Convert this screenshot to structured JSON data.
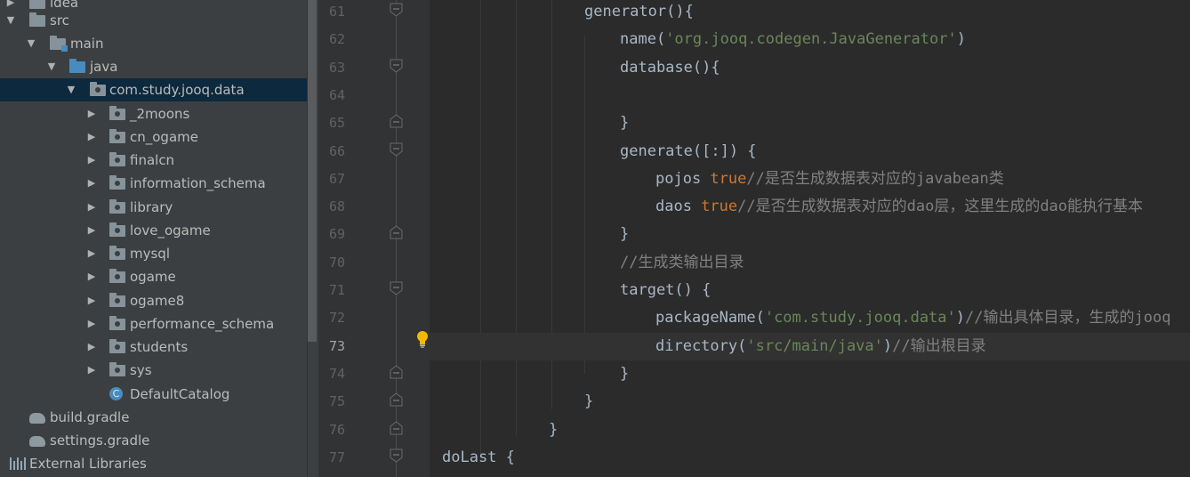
{
  "project_tree": {
    "items": [
      {
        "label": "idea",
        "kind": "folder",
        "expanded": false
      },
      {
        "label": "src",
        "kind": "folder",
        "expanded": true
      },
      {
        "label": "main",
        "kind": "source-folder",
        "expanded": true
      },
      {
        "label": "java",
        "kind": "source-root",
        "expanded": true
      },
      {
        "label": "com.study.jooq.data",
        "kind": "package",
        "expanded": true,
        "selected": true
      },
      {
        "label": "_2moons",
        "kind": "package",
        "expanded": false
      },
      {
        "label": "cn_ogame",
        "kind": "package",
        "expanded": false
      },
      {
        "label": "finalcn",
        "kind": "package",
        "expanded": false
      },
      {
        "label": "information_schema",
        "kind": "package",
        "expanded": false
      },
      {
        "label": "library",
        "kind": "package",
        "expanded": false
      },
      {
        "label": "love_ogame",
        "kind": "package",
        "expanded": false
      },
      {
        "label": "mysql",
        "kind": "package",
        "expanded": false
      },
      {
        "label": "ogame",
        "kind": "package",
        "expanded": false
      },
      {
        "label": "ogame8",
        "kind": "package",
        "expanded": false
      },
      {
        "label": "performance_schema",
        "kind": "package",
        "expanded": false
      },
      {
        "label": "students",
        "kind": "package",
        "expanded": false
      },
      {
        "label": "sys",
        "kind": "package",
        "expanded": false
      },
      {
        "label": "DefaultCatalog",
        "kind": "class",
        "icon_letter": "C"
      },
      {
        "label": "build.gradle",
        "kind": "gradle"
      },
      {
        "label": "settings.gradle",
        "kind": "gradle"
      },
      {
        "label": "External Libraries",
        "kind": "libraries"
      }
    ]
  },
  "editor": {
    "current_line": "73",
    "lines": [
      {
        "num": "61",
        "tokens": [
          {
            "t": "generator(){",
            "c": "plain"
          }
        ]
      },
      {
        "num": "62",
        "tokens": [
          {
            "t": "name(",
            "c": "plain"
          },
          {
            "t": "'org.jooq.codegen.JavaGenerator'",
            "c": "str"
          },
          {
            "t": ")",
            "c": "plain"
          }
        ]
      },
      {
        "num": "63",
        "tokens": [
          {
            "t": "database(){",
            "c": "plain"
          }
        ]
      },
      {
        "num": "64",
        "tokens": []
      },
      {
        "num": "65",
        "tokens": [
          {
            "t": "}",
            "c": "plain"
          }
        ]
      },
      {
        "num": "66",
        "tokens": [
          {
            "t": "generate([:]) {",
            "c": "plain"
          }
        ]
      },
      {
        "num": "67",
        "tokens": [
          {
            "t": "pojos ",
            "c": "plain"
          },
          {
            "t": "true",
            "c": "kw"
          },
          {
            "t": "//是否生成数据表对应的javabean类",
            "c": "cmt"
          }
        ]
      },
      {
        "num": "68",
        "tokens": [
          {
            "t": "daos ",
            "c": "plain"
          },
          {
            "t": "true",
            "c": "kw"
          },
          {
            "t": "//是否生成数据表对应的dao层，这里生成的dao能执行基本",
            "c": "cmt"
          }
        ]
      },
      {
        "num": "69",
        "tokens": [
          {
            "t": "}",
            "c": "plain"
          }
        ]
      },
      {
        "num": "70",
        "tokens": [
          {
            "t": "//生成类输出目录",
            "c": "cmt"
          }
        ]
      },
      {
        "num": "71",
        "tokens": [
          {
            "t": "target() {",
            "c": "plain"
          }
        ]
      },
      {
        "num": "72",
        "tokens": [
          {
            "t": "packageName(",
            "c": "plain"
          },
          {
            "t": "'com.study.jooq.data'",
            "c": "str"
          },
          {
            "t": ")",
            "c": "plain"
          },
          {
            "t": "//输出具体目录，生成的jooq",
            "c": "cmt"
          }
        ]
      },
      {
        "num": "73",
        "tokens": [
          {
            "t": "directory(",
            "c": "plain"
          },
          {
            "t": "'src/main/java'",
            "c": "str"
          },
          {
            "t": ")",
            "c": "plain"
          },
          {
            "t": "//输出根目录",
            "c": "cmt"
          }
        ]
      },
      {
        "num": "74",
        "tokens": [
          {
            "t": "}",
            "c": "plain"
          }
        ]
      },
      {
        "num": "75",
        "tokens": [
          {
            "t": "}",
            "c": "plain"
          }
        ]
      },
      {
        "num": "76",
        "tokens": [
          {
            "t": "}",
            "c": "plain"
          }
        ]
      },
      {
        "num": "77",
        "tokens": [
          {
            "t": "doLast {",
            "c": "plain"
          }
        ]
      }
    ]
  },
  "colors": {
    "tree_bg": "#3c3f41",
    "selection": "#0d293e",
    "editor_bg": "#2b2b2b",
    "gutter_bg": "#313335",
    "string": "#6a8759",
    "keyword": "#cc7832",
    "comment": "#808080",
    "text": "#a9b7c6",
    "bulb": "#f5b800"
  },
  "icons": {
    "folder": "folder-icon",
    "package": "package-icon",
    "class": "class-icon",
    "gradle": "gradle-icon",
    "libraries": "libraries-icon",
    "intention": "lightbulb-icon",
    "fold": "fold-marker-icon"
  }
}
